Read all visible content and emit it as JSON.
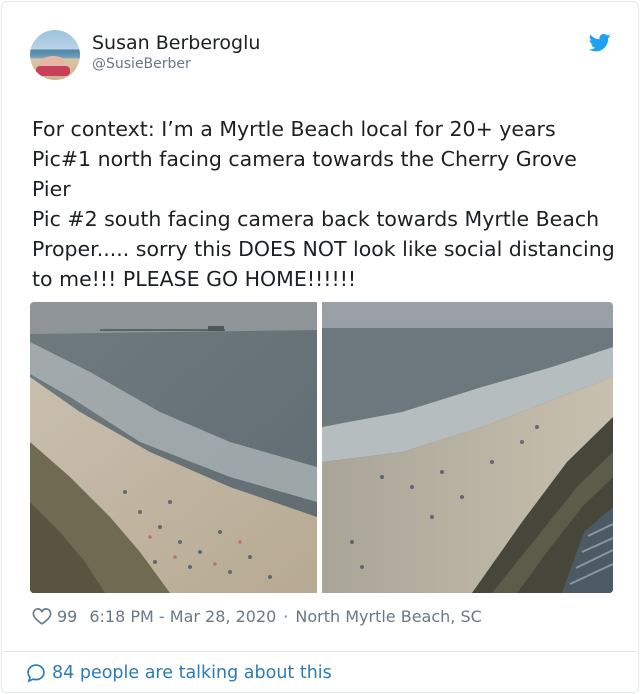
{
  "author": {
    "name": "Susan Berberoglu",
    "handle": "@SusieBerber",
    "avatar_icon": "profile-photo-beach"
  },
  "brand_icon": "twitter-bird-icon",
  "tweet": {
    "text": "For context: I’m a Myrtle Beach local for 20+ years\nPic#1 north facing camera towards the Cherry Grove Pier\nPic #2 south facing camera back towards Myrtle Beach Proper..... sorry this DOES NOT look like social distancing to me!!! PLEASE GO HOME!!!!!!"
  },
  "media": [
    {
      "name": "photo-north-cherry-grove-pier"
    },
    {
      "name": "photo-south-myrtle-beach"
    }
  ],
  "footer": {
    "likes": "99",
    "time": "6:18 PM - Mar 28, 2020",
    "separator": "·",
    "location": "North Myrtle Beach, SC"
  },
  "conversation": {
    "label": "84 people are talking about this"
  },
  "colors": {
    "brand": "#1da1f2",
    "link": "#2b7bb9",
    "muted": "#697882",
    "text": "#1c2022",
    "border": "#e1e8ed"
  }
}
